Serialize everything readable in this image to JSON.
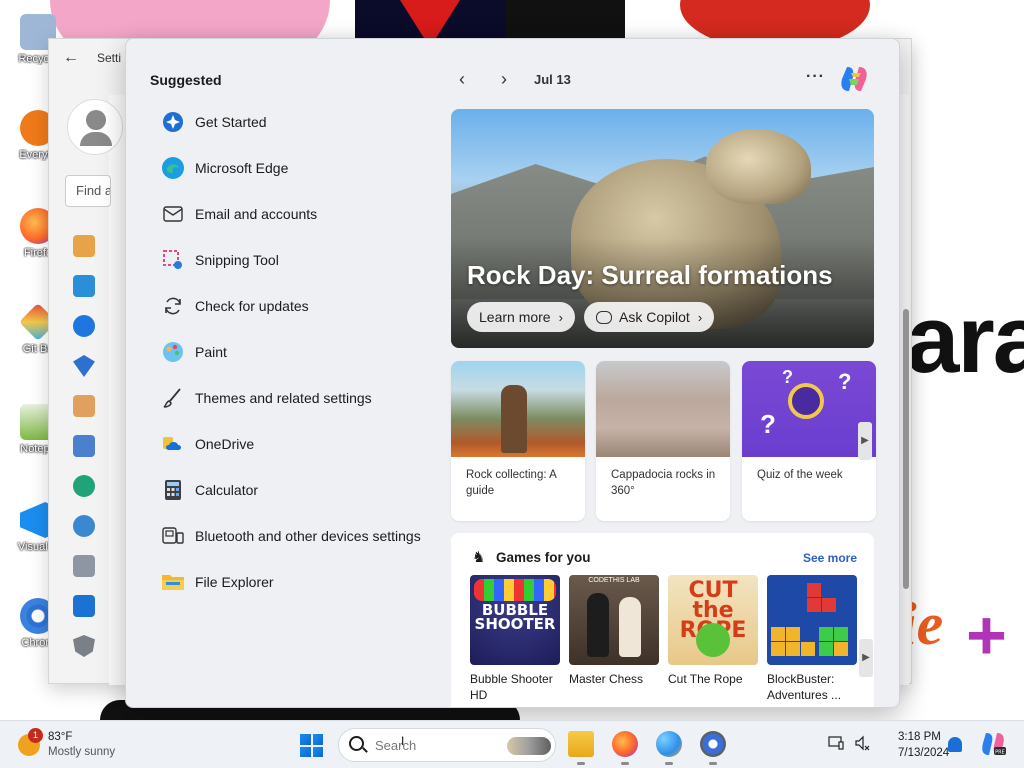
{
  "desktop": {
    "icons": [
      {
        "label": "Recycle",
        "icon": "recycle-bin-icon",
        "color": "#9fb7d6"
      },
      {
        "label": "Everyth",
        "icon": "everything-search-icon",
        "color": "#f07a1a"
      },
      {
        "label": "Firefo",
        "icon": "firefox-icon",
        "color": "#ff6a2a"
      },
      {
        "label": "Git Ba",
        "icon": "git-bash-icon",
        "color": "#e84a3a"
      },
      {
        "label": "Notepa",
        "icon": "notepad-icon",
        "color": "#7fb842"
      },
      {
        "label": "Visual S",
        "icon": "vscode-icon",
        "color": "#1a8ef0"
      },
      {
        "label": "Chrom",
        "icon": "chrome-icon",
        "color": "#2c74d4"
      }
    ],
    "wallpaper_text": {
      "ara": "ara",
      "ie": "ie",
      "plus": "+"
    }
  },
  "settings_window": {
    "back_glyph": "←",
    "title": "Setti",
    "find_placeholder": "Find a",
    "nav_icons": [
      "home-icon",
      "system-icon",
      "bluetooth-icon",
      "network-icon",
      "personalization-icon",
      "apps-icon",
      "accounts-icon",
      "time-language-icon",
      "gaming-icon",
      "accessibility-icon",
      "privacy-security-icon"
    ]
  },
  "start_menu": {
    "suggested_heading": "Suggested",
    "suggested": [
      {
        "label": "Get Started",
        "icon": "get-started-icon"
      },
      {
        "label": "Microsoft Edge",
        "icon": "edge-icon"
      },
      {
        "label": "Email and accounts",
        "icon": "mail-icon"
      },
      {
        "label": "Snipping Tool",
        "icon": "snipping-tool-icon"
      },
      {
        "label": "Check for updates",
        "icon": "update-icon"
      },
      {
        "label": "Paint",
        "icon": "paint-icon"
      },
      {
        "label": "Themes and related settings",
        "icon": "brush-icon"
      },
      {
        "label": "OneDrive",
        "icon": "onedrive-icon"
      },
      {
        "label": "Calculator",
        "icon": "calculator-icon"
      },
      {
        "label": "Bluetooth and other devices settings",
        "icon": "devices-icon"
      },
      {
        "label": "File Explorer",
        "icon": "file-explorer-icon"
      }
    ],
    "feed": {
      "prev_glyph": "‹",
      "next_glyph": "›",
      "date": "Jul 13",
      "more_glyph": "···",
      "hero": {
        "title": "Rock Day: Surreal formations",
        "learn_more": "Learn more",
        "ask_copilot": "Ask Copilot",
        "chevron": "›"
      },
      "cards": [
        {
          "caption": "Rock collecting: A guide"
        },
        {
          "caption": "Cappadocia rocks in 360°"
        },
        {
          "caption": "Quiz of the week"
        }
      ],
      "scroll_glyph": "▶",
      "games": {
        "heading": "Games for you",
        "see_more": "See more",
        "items": [
          {
            "name": "Bubble Shooter HD",
            "art_text": "BUBBLE SHOOTER"
          },
          {
            "name": "Master Chess",
            "art_text": "CODETHIS LAB"
          },
          {
            "name": "Cut The Rope",
            "art_text": "CUT the ROPE"
          },
          {
            "name": "BlockBuster: Adventures ...",
            "art_text": ""
          }
        ]
      }
    }
  },
  "taskbar": {
    "weather": {
      "badge": "1",
      "temp": "83°F",
      "condition": "Mostly sunny"
    },
    "search_placeholder": "Search",
    "apps": [
      "file-explorer-icon",
      "firefox-icon",
      "paint-icon",
      "settings-icon"
    ],
    "tray": [
      "display-icon",
      "volume-icon"
    ],
    "time": "3:18 PM",
    "date": "7/13/2024",
    "cursor_glyph": "I"
  }
}
